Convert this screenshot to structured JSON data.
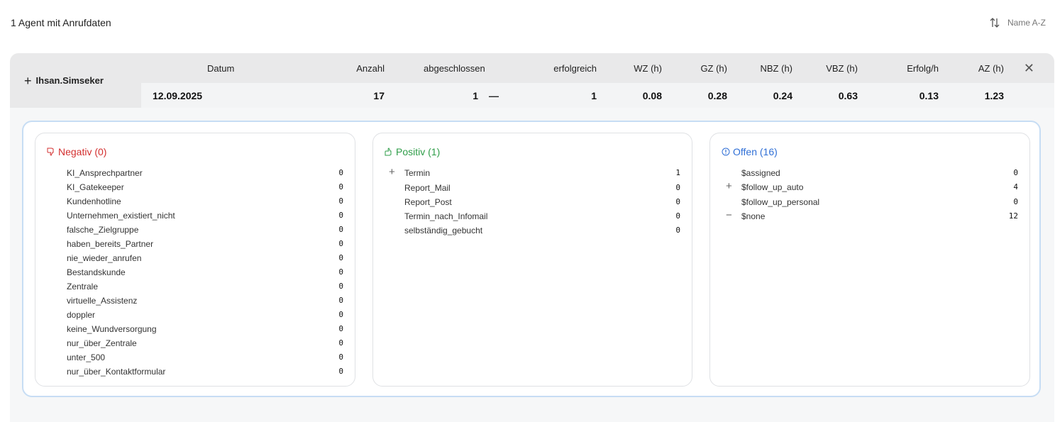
{
  "header": {
    "agent_count": "1 Agent mit Anrufdaten",
    "sort_label": "Name A-Z"
  },
  "agent": {
    "name": "Ihsan.Simseker",
    "columns": [
      "Datum",
      "Anzahl",
      "abgeschlossen",
      "erfolgreich",
      "WZ (h)",
      "GZ (h)",
      "NBZ (h)",
      "VBZ (h)",
      "Erfolg/h",
      "AZ (h)"
    ],
    "values": [
      "12.09.2025",
      "17",
      "1",
      "1",
      "0.08",
      "0.28",
      "0.24",
      "0.63",
      "0.13",
      "1.23"
    ]
  },
  "panels": {
    "negativ": {
      "title": "Negativ (0)",
      "items": [
        {
          "label": "KI_Ansprechpartner",
          "value": "0"
        },
        {
          "label": "KI_Gatekeeper",
          "value": "0"
        },
        {
          "label": "Kundenhotline",
          "value": "0"
        },
        {
          "label": "Unternehmen_existiert_nicht",
          "value": "0"
        },
        {
          "label": "falsche_Zielgruppe",
          "value": "0"
        },
        {
          "label": "haben_bereits_Partner",
          "value": "0"
        },
        {
          "label": "nie_wieder_anrufen",
          "value": "0"
        },
        {
          "label": "Bestandskunde",
          "value": "0"
        },
        {
          "label": "Zentrale",
          "value": "0"
        },
        {
          "label": "virtuelle_Assistenz",
          "value": "0"
        },
        {
          "label": "doppler",
          "value": "0"
        },
        {
          "label": "keine_Wundversorgung",
          "value": "0"
        },
        {
          "label": "nur_über_Zentrale",
          "value": "0"
        },
        {
          "label": "unter_500",
          "value": "0"
        },
        {
          "label": "nur_über_Kontaktformular",
          "value": "0"
        }
      ]
    },
    "positiv": {
      "title": "Positiv (1)",
      "items": [
        {
          "label": "Termin",
          "value": "1"
        },
        {
          "label": "Report_Mail",
          "value": "0"
        },
        {
          "label": "Report_Post",
          "value": "0"
        },
        {
          "label": "Termin_nach_Infomail",
          "value": "0"
        },
        {
          "label": "selbständig_gebucht",
          "value": "0"
        }
      ]
    },
    "offen": {
      "title": "Offen (16)",
      "items": [
        {
          "label": "$assigned",
          "value": "0"
        },
        {
          "label": "$follow_up_auto",
          "value": "4"
        },
        {
          "label": "$follow_up_personal",
          "value": "0"
        },
        {
          "label": "$none",
          "value": "12"
        }
      ]
    }
  }
}
